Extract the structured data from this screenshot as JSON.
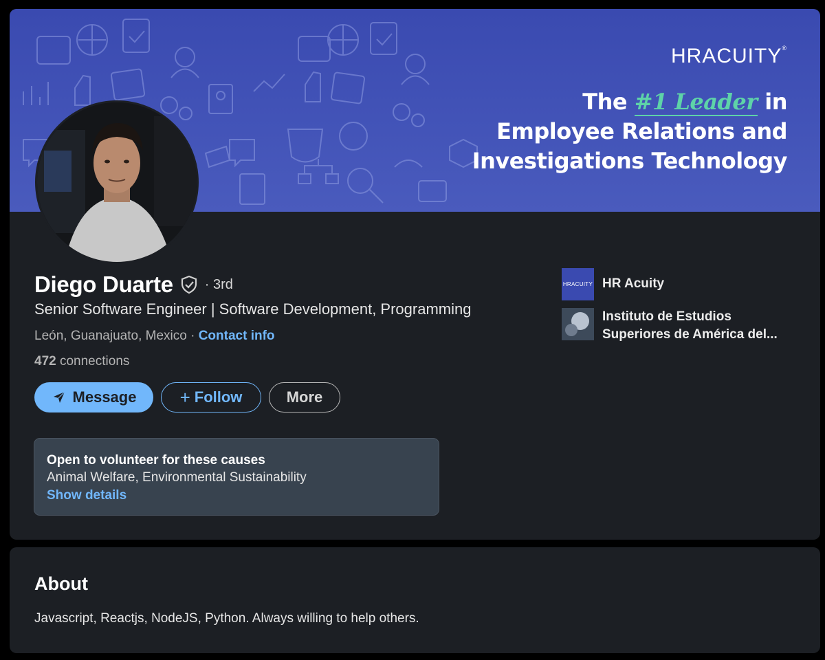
{
  "banner": {
    "logo_hr": "HR",
    "logo_acuity": "ACUITY",
    "logo_reg": "®",
    "tagline_pre": "The ",
    "tagline_highlight": "#1 Leader",
    "tagline_post": " in",
    "tagline_line2": "Employee Relations and",
    "tagline_line3": "Investigations Technology",
    "highlight_color": "#5ed3a8"
  },
  "profile": {
    "name": "Diego Duarte",
    "verified_icon": "shield-check-icon",
    "degree": "· 3rd",
    "headline": "Senior Software Engineer | Software Development, Programming",
    "location": "León, Guanajuato, Mexico · ",
    "contact_info": "Contact info",
    "connections_count": "472",
    "connections_label": " connections"
  },
  "actions": {
    "message": "Message",
    "follow": "Follow",
    "follow_prefix": "+",
    "more": "More"
  },
  "volunteer": {
    "title": "Open to volunteer for these causes",
    "causes": "Animal Welfare, Environmental Sustainability",
    "details": "Show details"
  },
  "sidebar": {
    "items": [
      {
        "label": "HR Acuity",
        "logo_text": "HRACUITY"
      },
      {
        "label_line1": "Instituto de Estudios",
        "label_line2": "Superiores de América del..."
      }
    ]
  },
  "about": {
    "title": "About",
    "text": "Javascript, Reactjs, NodeJS, Python. Always willing to help others."
  },
  "colors": {
    "accent": "#71b7fb",
    "card_bg": "#1c1f24",
    "banner_bg": "#3a4ab0"
  }
}
